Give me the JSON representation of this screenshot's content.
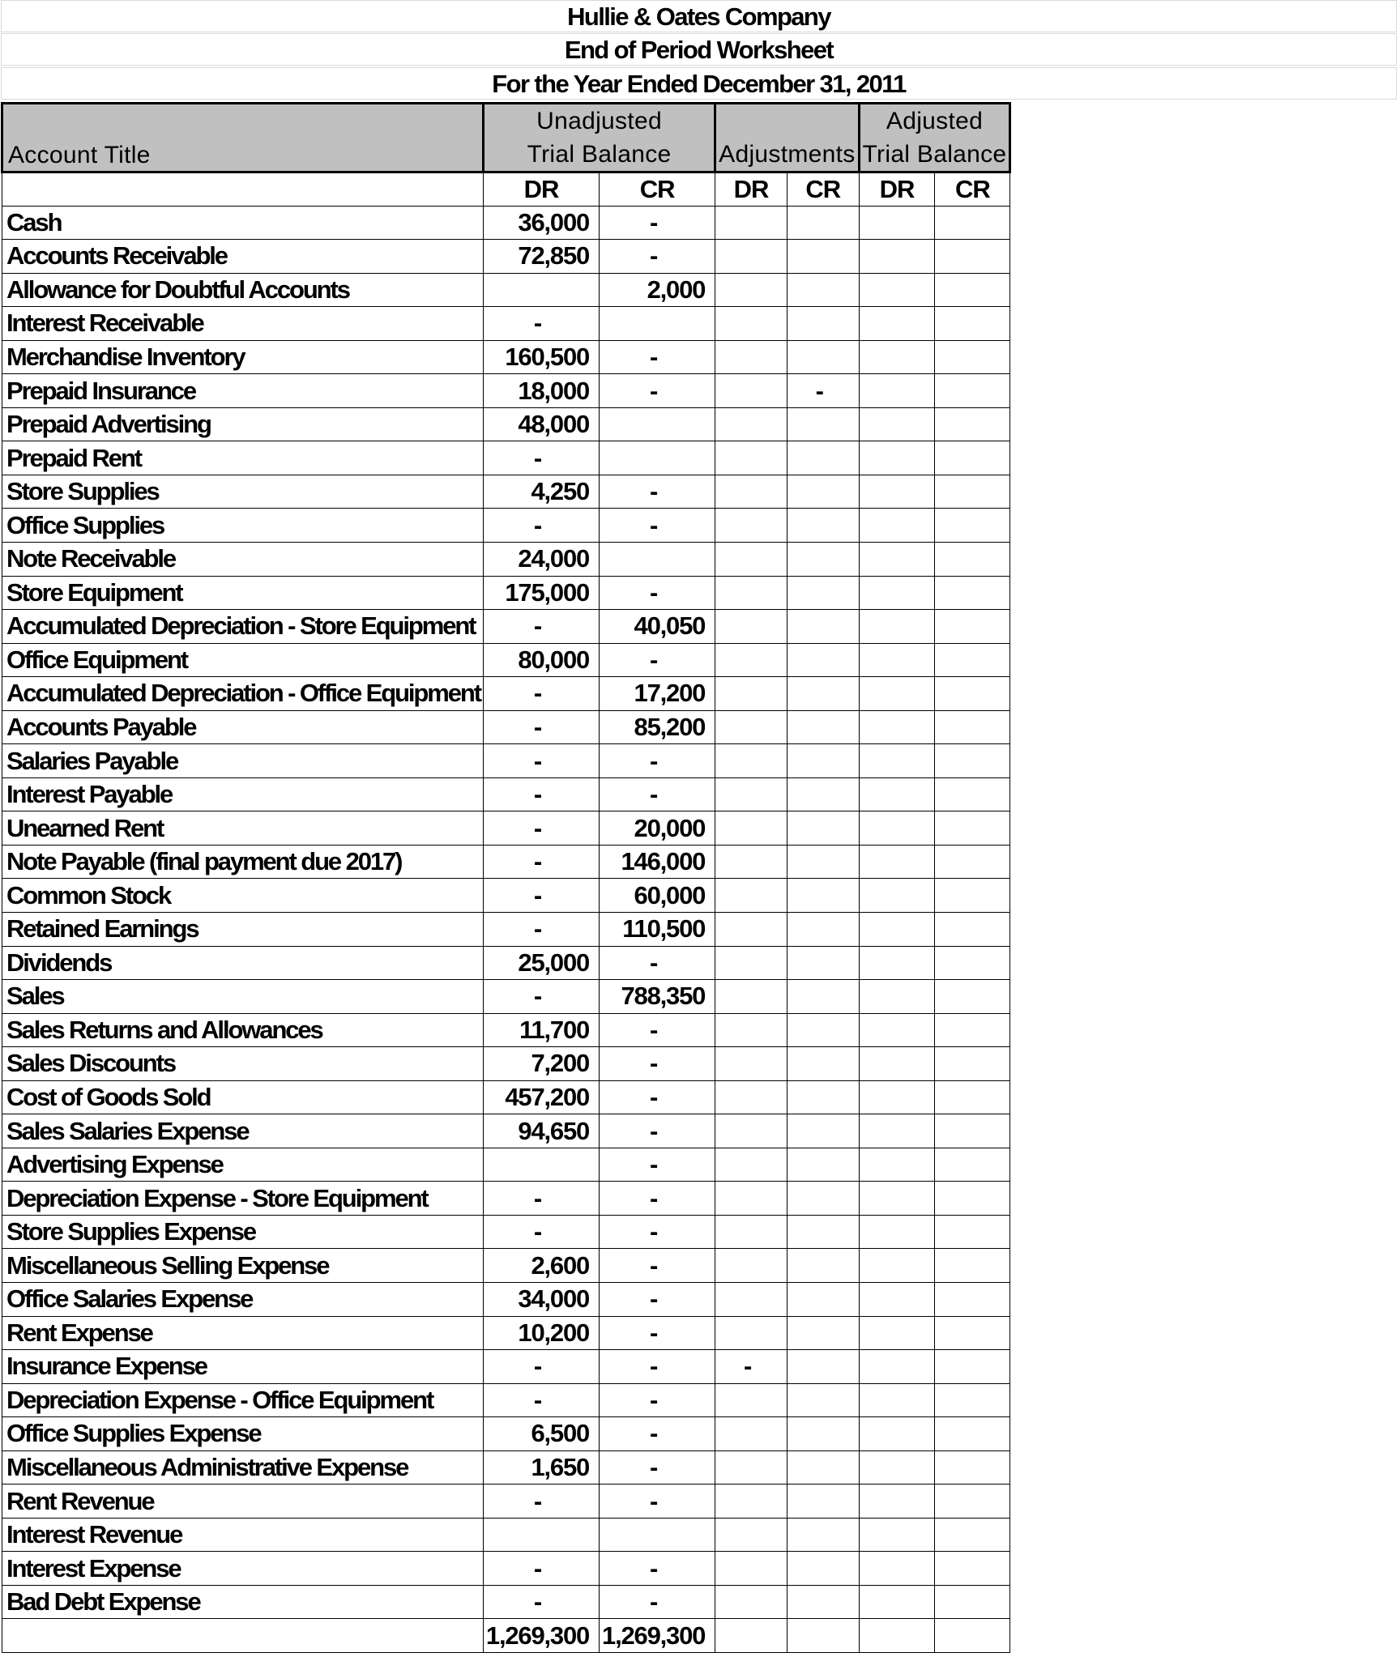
{
  "title": {
    "company": "Hullie & Oates Company",
    "report": "End of Period Worksheet",
    "period": "For the Year Ended December 31, 2011"
  },
  "headers": {
    "account_title": "Account Title",
    "unadjusted_line1": "Unadjusted",
    "unadjusted_line2": "Trial Balance",
    "adjustments": "Adjustments",
    "adjusted_line1": "Adjusted",
    "adjusted_line2": "Trial Balance",
    "dr": "DR",
    "cr": "CR"
  },
  "rows": [
    {
      "account": "Cash",
      "utb_dr": "36,000",
      "utb_cr": "-",
      "adj_dr": "",
      "adj_cr": "",
      "atb_dr": "",
      "atb_cr": ""
    },
    {
      "account": "Accounts Receivable",
      "utb_dr": "72,850",
      "utb_cr": "-",
      "adj_dr": "",
      "adj_cr": "",
      "atb_dr": "",
      "atb_cr": ""
    },
    {
      "account": "Allowance for Doubtful Accounts",
      "utb_dr": "",
      "utb_cr": "2,000",
      "adj_dr": "",
      "adj_cr": "",
      "atb_dr": "",
      "atb_cr": ""
    },
    {
      "account": "Interest Receivable",
      "utb_dr": "-",
      "utb_cr": "",
      "adj_dr": "",
      "adj_cr": "",
      "atb_dr": "",
      "atb_cr": ""
    },
    {
      "account": "Merchandise Inventory",
      "utb_dr": "160,500",
      "utb_cr": "-",
      "adj_dr": "",
      "adj_cr": "",
      "atb_dr": "",
      "atb_cr": ""
    },
    {
      "account": "Prepaid Insurance",
      "utb_dr": "18,000",
      "utb_cr": "-",
      "adj_dr": "",
      "adj_cr": "-",
      "atb_dr": "",
      "atb_cr": ""
    },
    {
      "account": "Prepaid Advertising",
      "utb_dr": "48,000",
      "utb_cr": "",
      "adj_dr": "",
      "adj_cr": "",
      "atb_dr": "",
      "atb_cr": ""
    },
    {
      "account": "Prepaid Rent",
      "utb_dr": "-",
      "utb_cr": "",
      "adj_dr": "",
      "adj_cr": "",
      "atb_dr": "",
      "atb_cr": ""
    },
    {
      "account": "Store Supplies",
      "utb_dr": "4,250",
      "utb_cr": "-",
      "adj_dr": "",
      "adj_cr": "",
      "atb_dr": "",
      "atb_cr": ""
    },
    {
      "account": "Office Supplies",
      "utb_dr": "-",
      "utb_cr": "-",
      "adj_dr": "",
      "adj_cr": "",
      "atb_dr": "",
      "atb_cr": ""
    },
    {
      "account": "Note Receivable",
      "utb_dr": "24,000",
      "utb_cr": "",
      "adj_dr": "",
      "adj_cr": "",
      "atb_dr": "",
      "atb_cr": ""
    },
    {
      "account": "Store Equipment",
      "utb_dr": "175,000",
      "utb_cr": "-",
      "adj_dr": "",
      "adj_cr": "",
      "atb_dr": "",
      "atb_cr": ""
    },
    {
      "account": "Accumulated Depreciation - Store Equipment",
      "utb_dr": "-",
      "utb_cr": "40,050",
      "adj_dr": "",
      "adj_cr": "",
      "atb_dr": "",
      "atb_cr": ""
    },
    {
      "account": "Office Equipment",
      "utb_dr": "80,000",
      "utb_cr": "-",
      "adj_dr": "",
      "adj_cr": "",
      "atb_dr": "",
      "atb_cr": ""
    },
    {
      "account": "Accumulated Depreciation - Office Equipment",
      "utb_dr": "-",
      "utb_cr": "17,200",
      "adj_dr": "",
      "adj_cr": "",
      "atb_dr": "",
      "atb_cr": ""
    },
    {
      "account": "Accounts Payable",
      "utb_dr": "-",
      "utb_cr": "85,200",
      "adj_dr": "",
      "adj_cr": "",
      "atb_dr": "",
      "atb_cr": ""
    },
    {
      "account": "Salaries Payable",
      "utb_dr": "-",
      "utb_cr": "-",
      "adj_dr": "",
      "adj_cr": "",
      "atb_dr": "",
      "atb_cr": ""
    },
    {
      "account": "Interest Payable",
      "utb_dr": "-",
      "utb_cr": "-",
      "adj_dr": "",
      "adj_cr": "",
      "atb_dr": "",
      "atb_cr": ""
    },
    {
      "account": "Unearned Rent",
      "utb_dr": "-",
      "utb_cr": "20,000",
      "adj_dr": "",
      "adj_cr": "",
      "atb_dr": "",
      "atb_cr": ""
    },
    {
      "account": "Note Payable (final payment due 2017)",
      "utb_dr": "-",
      "utb_cr": "146,000",
      "adj_dr": "",
      "adj_cr": "",
      "atb_dr": "",
      "atb_cr": ""
    },
    {
      "account": "Common Stock",
      "utb_dr": "-",
      "utb_cr": "60,000",
      "adj_dr": "",
      "adj_cr": "",
      "atb_dr": "",
      "atb_cr": ""
    },
    {
      "account": "Retained Earnings",
      "utb_dr": "-",
      "utb_cr": "110,500",
      "adj_dr": "",
      "adj_cr": "",
      "atb_dr": "",
      "atb_cr": ""
    },
    {
      "account": "Dividends",
      "utb_dr": "25,000",
      "utb_cr": "-",
      "adj_dr": "",
      "adj_cr": "",
      "atb_dr": "",
      "atb_cr": ""
    },
    {
      "account": "Sales",
      "utb_dr": "-",
      "utb_cr": "788,350",
      "adj_dr": "",
      "adj_cr": "",
      "atb_dr": "",
      "atb_cr": ""
    },
    {
      "account": "Sales Returns and Allowances",
      "utb_dr": "11,700",
      "utb_cr": "-",
      "adj_dr": "",
      "adj_cr": "",
      "atb_dr": "",
      "atb_cr": ""
    },
    {
      "account": "Sales Discounts",
      "utb_dr": "7,200",
      "utb_cr": "-",
      "adj_dr": "",
      "adj_cr": "",
      "atb_dr": "",
      "atb_cr": ""
    },
    {
      "account": "Cost of Goods Sold",
      "utb_dr": "457,200",
      "utb_cr": "-",
      "adj_dr": "",
      "adj_cr": "",
      "atb_dr": "",
      "atb_cr": ""
    },
    {
      "account": "Sales Salaries Expense",
      "utb_dr": "94,650",
      "utb_cr": "-",
      "adj_dr": "",
      "adj_cr": "",
      "atb_dr": "",
      "atb_cr": ""
    },
    {
      "account": "Advertising Expense",
      "utb_dr": "",
      "utb_cr": "-",
      "adj_dr": "",
      "adj_cr": "",
      "atb_dr": "",
      "atb_cr": ""
    },
    {
      "account": "Depreciation Expense - Store Equipment",
      "utb_dr": "-",
      "utb_cr": "-",
      "adj_dr": "",
      "adj_cr": "",
      "atb_dr": "",
      "atb_cr": ""
    },
    {
      "account": "Store Supplies Expense",
      "utb_dr": "-",
      "utb_cr": "-",
      "adj_dr": "",
      "adj_cr": "",
      "atb_dr": "",
      "atb_cr": ""
    },
    {
      "account": "Miscellaneous Selling Expense",
      "utb_dr": "2,600",
      "utb_cr": "-",
      "adj_dr": "",
      "adj_cr": "",
      "atb_dr": "",
      "atb_cr": ""
    },
    {
      "account": "Office Salaries Expense",
      "utb_dr": "34,000",
      "utb_cr": "-",
      "adj_dr": "",
      "adj_cr": "",
      "atb_dr": "",
      "atb_cr": ""
    },
    {
      "account": "Rent Expense",
      "utb_dr": "10,200",
      "utb_cr": "-",
      "adj_dr": "",
      "adj_cr": "",
      "atb_dr": "",
      "atb_cr": ""
    },
    {
      "account": "Insurance Expense",
      "utb_dr": "-",
      "utb_cr": "-",
      "adj_dr": "-",
      "adj_cr": "",
      "atb_dr": "",
      "atb_cr": ""
    },
    {
      "account": "Depreciation Expense - Office Equipment",
      "utb_dr": "-",
      "utb_cr": "-",
      "adj_dr": "",
      "adj_cr": "",
      "atb_dr": "",
      "atb_cr": ""
    },
    {
      "account": "Office Supplies Expense",
      "utb_dr": "6,500",
      "utb_cr": "-",
      "adj_dr": "",
      "adj_cr": "",
      "atb_dr": "",
      "atb_cr": ""
    },
    {
      "account": "Miscellaneous Administrative Expense",
      "utb_dr": "1,650",
      "utb_cr": "-",
      "adj_dr": "",
      "adj_cr": "",
      "atb_dr": "",
      "atb_cr": ""
    },
    {
      "account": "Rent Revenue",
      "utb_dr": "-",
      "utb_cr": "-",
      "adj_dr": "",
      "adj_cr": "",
      "atb_dr": "",
      "atb_cr": ""
    },
    {
      "account": "Interest Revenue",
      "utb_dr": "",
      "utb_cr": "",
      "adj_dr": "",
      "adj_cr": "",
      "atb_dr": "",
      "atb_cr": ""
    },
    {
      "account": "Interest Expense",
      "utb_dr": "-",
      "utb_cr": "-",
      "adj_dr": "",
      "adj_cr": "",
      "atb_dr": "",
      "atb_cr": ""
    },
    {
      "account": "Bad Debt Expense",
      "utb_dr": "-",
      "utb_cr": "-",
      "adj_dr": "",
      "adj_cr": "",
      "atb_dr": "",
      "atb_cr": ""
    }
  ],
  "totals": {
    "account": "",
    "utb_dr": "1,269,300",
    "utb_cr": "1,269,300",
    "adj_dr": "",
    "adj_cr": "",
    "atb_dr": "",
    "atb_cr": ""
  }
}
